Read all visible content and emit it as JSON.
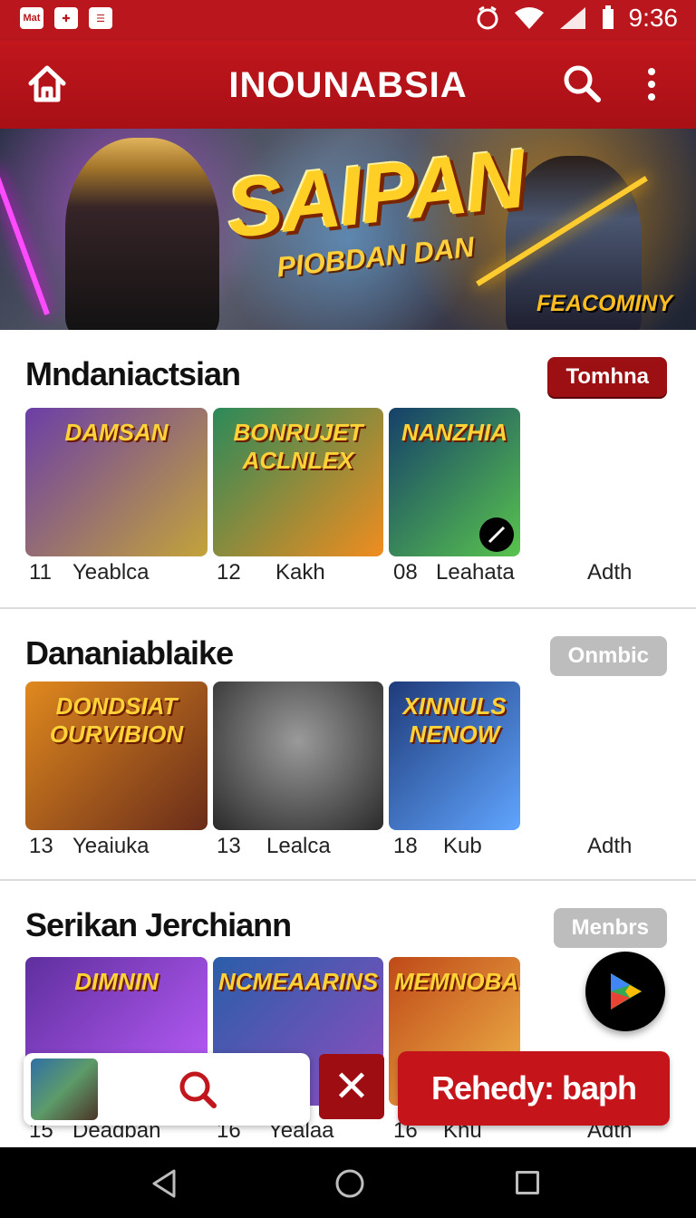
{
  "status_bar": {
    "left_icons": [
      "Mat",
      "✚",
      "☰"
    ],
    "time": "9:36",
    "icons": [
      "alarm-icon",
      "wifi-icon",
      "signal-icon",
      "battery-icon"
    ]
  },
  "app_bar": {
    "title": "INOUNABSIA",
    "icons": [
      "home-icon",
      "search-icon",
      "more-vert-icon"
    ]
  },
  "banner": {
    "title": "SAIPAN",
    "subtitle": "PIOBDAN DAN",
    "brand": "FEACOMINY"
  },
  "sections": [
    {
      "title": "Mndaniactsian",
      "button": "Tomhna",
      "button_style": "red",
      "cards": [
        {
          "name": "DAMSAN",
          "num": "11",
          "label": "Yeablca",
          "colors": [
            "#6b3ea7",
            "#c3a33a"
          ]
        },
        {
          "name": "BONRUJET ACLNLEX",
          "num": "12",
          "label": "Kakh",
          "colors": [
            "#2b8a5a",
            "#f08c1f"
          ]
        },
        {
          "name": "NANZHIA",
          "num": "08",
          "label": "Leahata",
          "colors": [
            "#15406a",
            "#59c44d"
          ]
        }
      ],
      "extra_label": "Adth"
    },
    {
      "title": "Dananiablaike",
      "button": "Onmbic",
      "button_style": "gray",
      "cards": [
        {
          "name": "DONDSIAT OURVIBION",
          "num": "13",
          "label": "Yeaiuka",
          "colors": [
            "#e0891e",
            "#692c1a"
          ]
        },
        {
          "name": "",
          "num": "13",
          "label": "Lealca",
          "colors": [
            "#707070",
            "#2a2a2a"
          ]
        },
        {
          "name": "XINNULS NENOW",
          "num": "18",
          "label": "Kub",
          "colors": [
            "#1f3b7a",
            "#60a5ff"
          ]
        }
      ],
      "extra_label": "Adth"
    },
    {
      "title": "Serikan Jerchiann",
      "button": "Menbrs",
      "button_style": "gray",
      "cards": [
        {
          "name": "DIMNIN",
          "num": "15",
          "label": "Deadban",
          "colors": [
            "#5f2f9e",
            "#bf5fff"
          ]
        },
        {
          "name": "NCMEAARINS",
          "num": "16",
          "label": "Yealaa",
          "colors": [
            "#2a5ea8",
            "#8f4dbf"
          ]
        },
        {
          "name": "MEMNOBAAN",
          "num": "16",
          "label": "Khu",
          "colors": [
            "#bf4a18",
            "#f1b64a"
          ]
        }
      ],
      "extra_label": "Adth"
    }
  ],
  "bottom_bar": {
    "cta_label": "Rehedy: baph",
    "close_label": "✕",
    "icons": [
      "search-icon",
      "close-icon",
      "play-icon",
      "avatar"
    ]
  },
  "nav_bar": {
    "icons": [
      "back-icon",
      "home-icon",
      "recent-apps-icon"
    ]
  }
}
